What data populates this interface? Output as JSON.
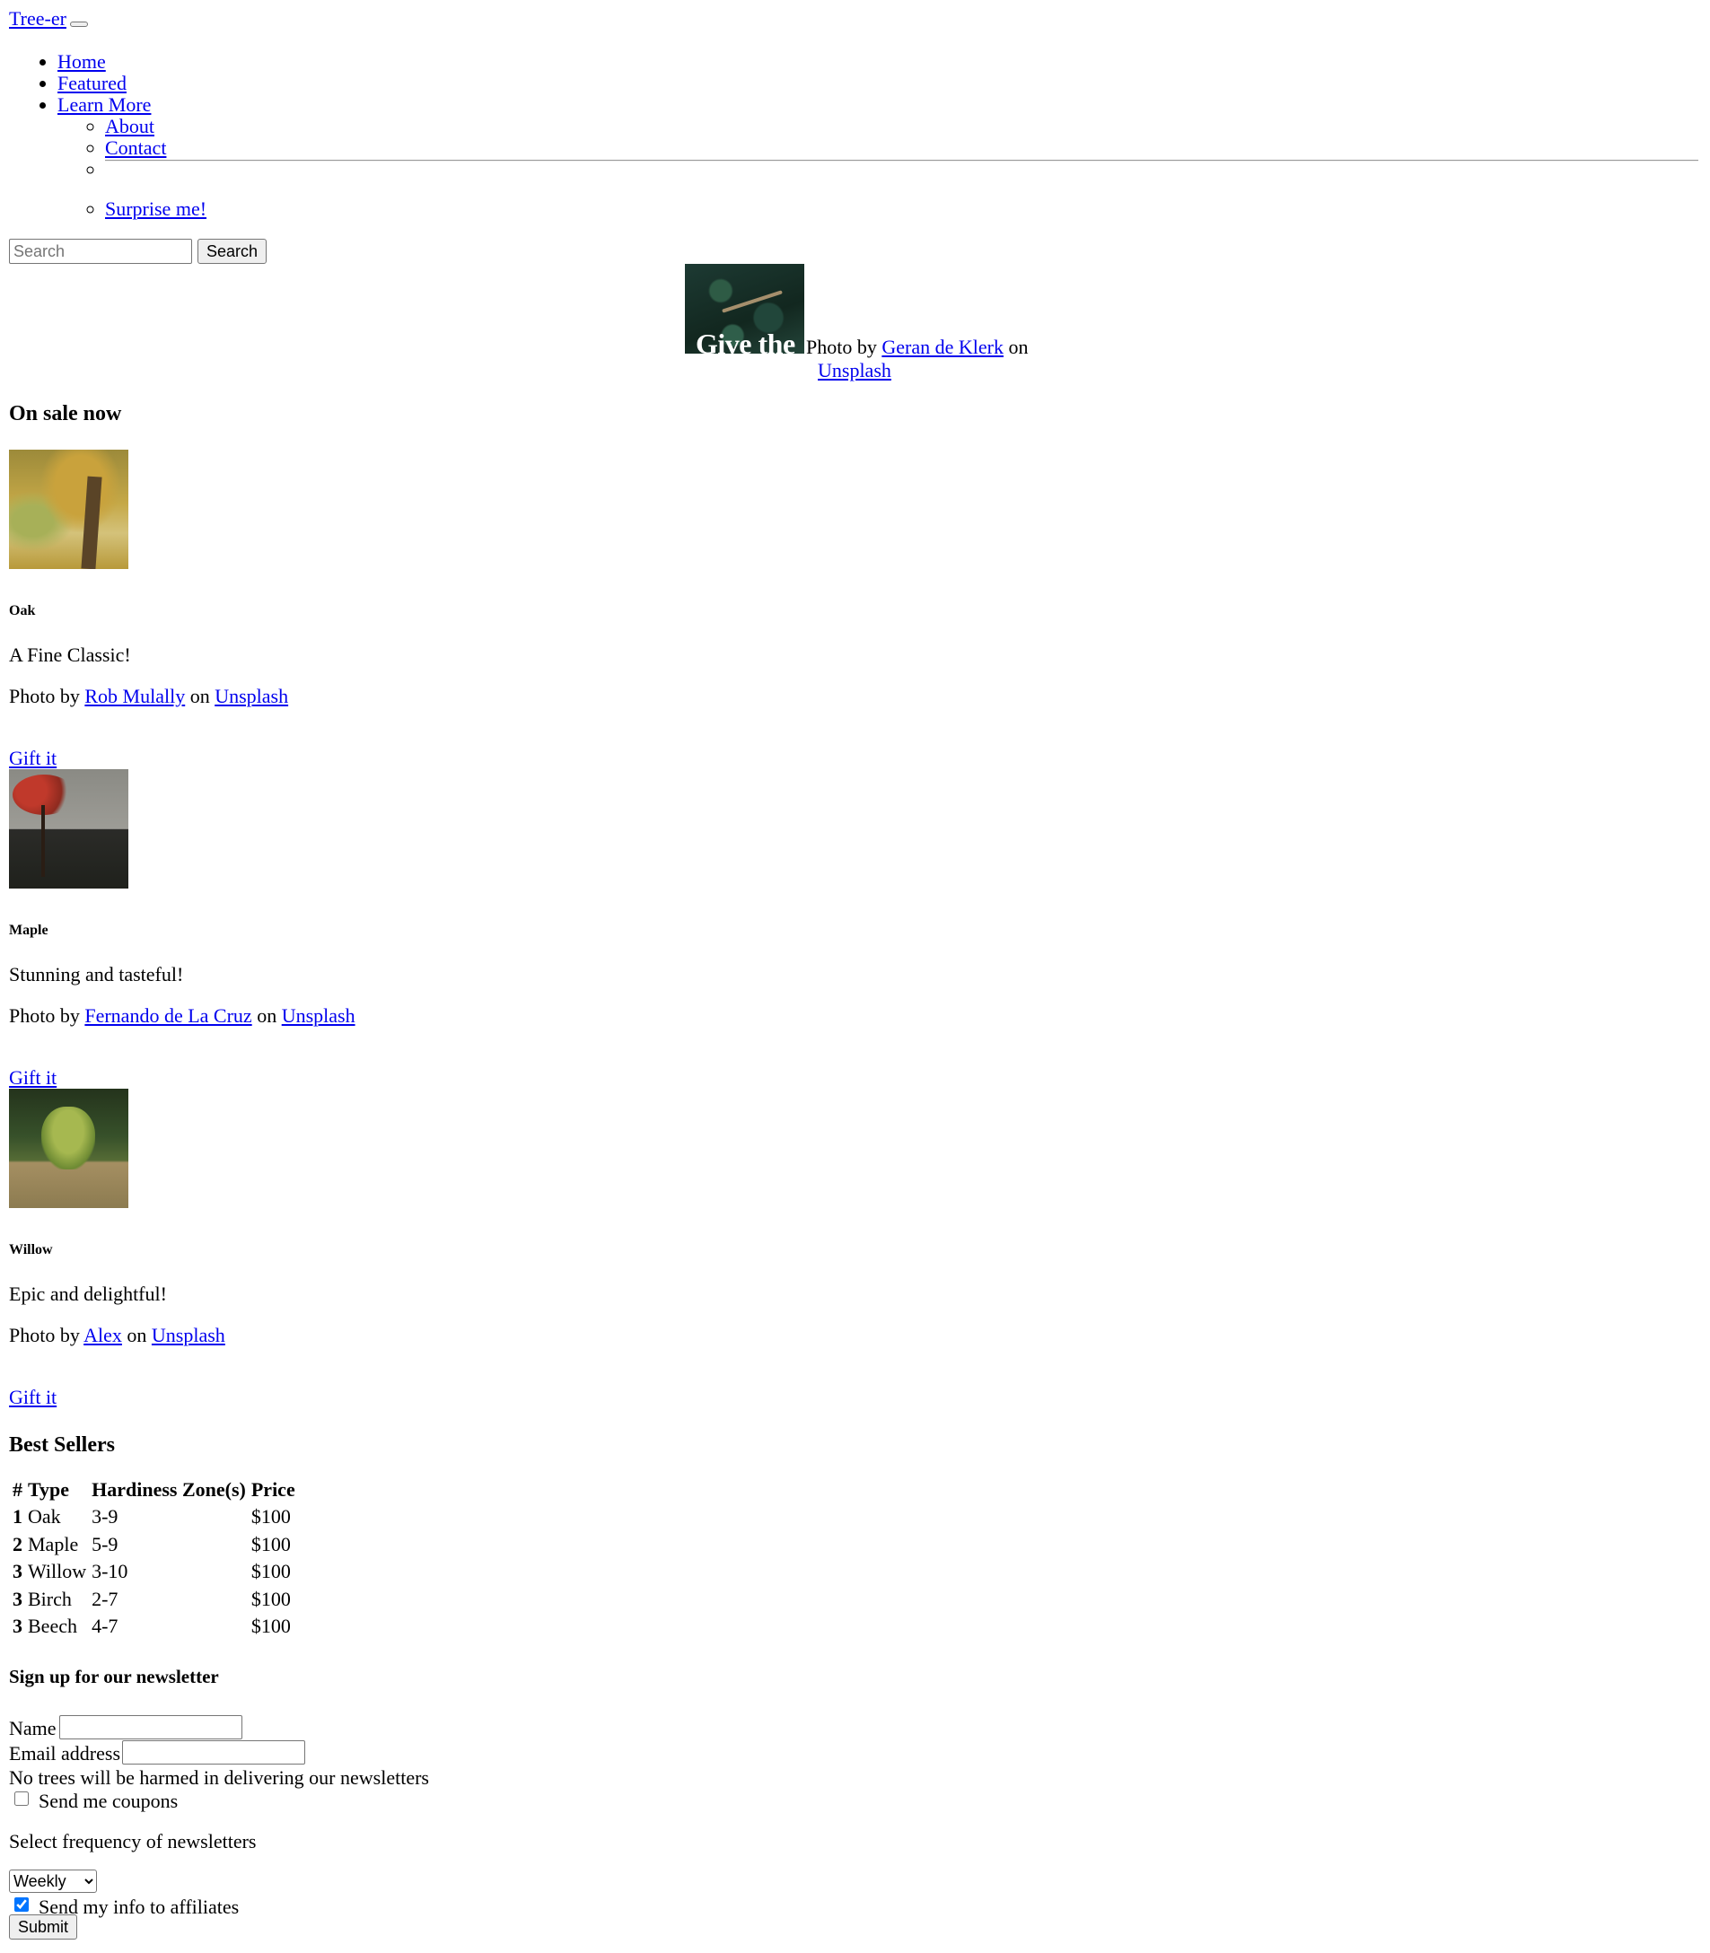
{
  "navbar": {
    "brand": "Tree-er",
    "items": [
      {
        "label": "Home"
      },
      {
        "label": "Featured"
      },
      {
        "label": "Learn More"
      }
    ],
    "submenu": [
      {
        "label": "About"
      },
      {
        "label": "Contact"
      },
      {
        "label": "Surprise me!"
      }
    ]
  },
  "search": {
    "placeholder": "Search",
    "button_label": "Search"
  },
  "hero": {
    "title": "Give the",
    "credit_prefix": "Photo by",
    "credit_author": "Geran de Klerk",
    "credit_mid": "on",
    "credit_site": "Unsplash"
  },
  "on_sale": {
    "heading": "On sale now",
    "cards": [
      {
        "title": "Oak",
        "text": "A Fine Classic!",
        "credit_prefix": "Photo by",
        "author": "Rob Mulally",
        "credit_mid": "on",
        "site": "Unsplash",
        "cta": "Gift it"
      },
      {
        "title": "Maple",
        "text": "Stunning and tasteful!",
        "credit_prefix": "Photo by",
        "author": "Fernando de La Cruz",
        "credit_mid": "on",
        "site": "Unsplash",
        "cta": "Gift it"
      },
      {
        "title": "Willow",
        "text": "Epic and delightful!",
        "credit_prefix": "Photo by",
        "author": "Alex",
        "credit_mid": "on",
        "site": "Unsplash",
        "cta": "Gift it"
      }
    ]
  },
  "best_sellers": {
    "heading": "Best Sellers",
    "columns": [
      "#",
      "Type",
      "Hardiness Zone(s)",
      "Price"
    ],
    "rows": [
      {
        "rank": "1",
        "type": "Oak",
        "zones": "3-9",
        "price": "$100"
      },
      {
        "rank": "2",
        "type": "Maple",
        "zones": "5-9",
        "price": "$100"
      },
      {
        "rank": "3",
        "type": "Willow",
        "zones": "3-10",
        "price": "$100"
      },
      {
        "rank": "3",
        "type": "Birch",
        "zones": "2-7",
        "price": "$100"
      },
      {
        "rank": "3",
        "type": "Beech",
        "zones": "4-7",
        "price": "$100"
      }
    ]
  },
  "newsletter": {
    "heading": "Sign up for our newsletter",
    "name_label": "Name",
    "name_value": "",
    "email_label": "Email address",
    "email_value": "",
    "email_help": "No trees will be harmed in delivering our newsletters",
    "coupons_label": "Send me coupons",
    "coupons_checked": false,
    "frequency_label": "Select frequency of newsletters",
    "frequency_selected": "Weekly",
    "affiliates_label": "Send my info to affiliates",
    "affiliates_checked": true,
    "submit_label": "Submit"
  }
}
